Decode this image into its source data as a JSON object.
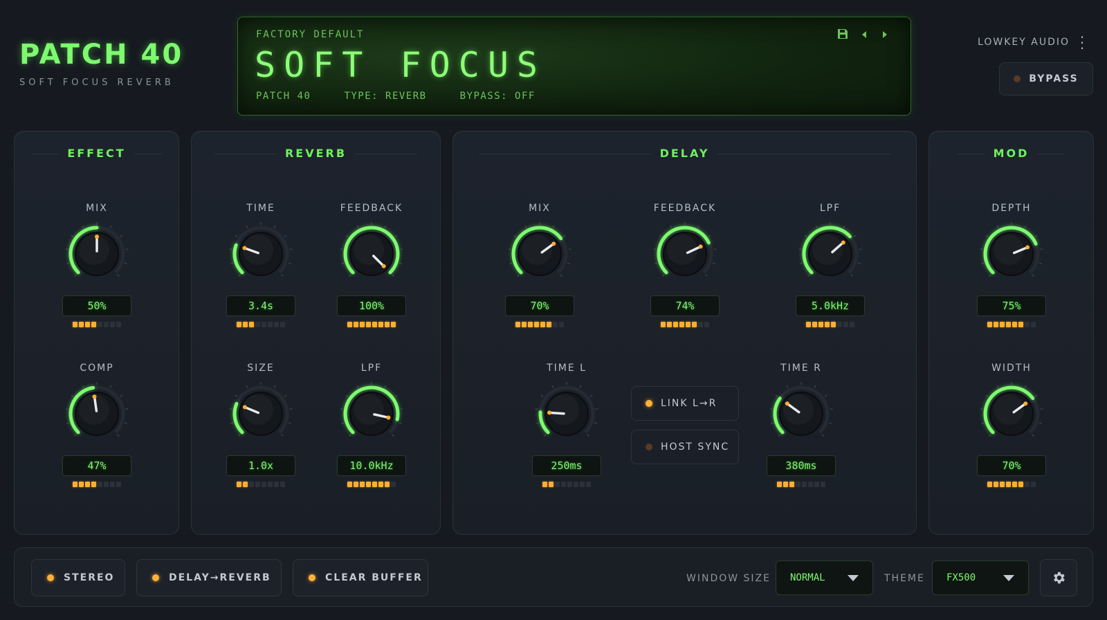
{
  "brand": {
    "title": "PATCH 40",
    "subtitle": "SOFT FOCUS REVERB"
  },
  "display": {
    "category": "FACTORY DEFAULT",
    "preset_name": "SOFT FOCUS",
    "info": [
      "PATCH 40",
      "TYPE: REVERB",
      "BYPASS: OFF"
    ],
    "icons": [
      "save-icon",
      "prev-preset-icon",
      "next-preset-icon"
    ]
  },
  "vendor": {
    "name": "LOWKEY AUDIO",
    "menu_icon": "kebab-menu-icon"
  },
  "bypass": {
    "label": "BYPASS",
    "active": false
  },
  "colors": {
    "accent_green": "#7dfa6e",
    "led_amber": "#ffae33",
    "panel_bg": "#1c222a"
  },
  "panels": {
    "effect": {
      "title": "EFFECT",
      "knobs": [
        {
          "label": "MIX",
          "value": "50%",
          "level": 0.5,
          "segments": 4
        },
        {
          "label": "COMP",
          "value": "47%",
          "level": 0.47,
          "segments": 4
        }
      ]
    },
    "reverb": {
      "title": "REVERB",
      "knobs": [
        {
          "label": "TIME",
          "value": "3.4s",
          "level": 0.24,
          "segments": 3
        },
        {
          "label": "FEEDBACK",
          "value": "100%",
          "level": 1.0,
          "segments": 8
        },
        {
          "label": "SIZE",
          "value": "1.0x",
          "level": 0.25,
          "segments": 2
        },
        {
          "label": "LPF",
          "value": "10.0kHz",
          "level": 0.88,
          "segments": 7
        }
      ]
    },
    "delay": {
      "title": "DELAY",
      "knobs": [
        {
          "label": "MIX",
          "value": "70%",
          "level": 0.7,
          "segments": 6
        },
        {
          "label": "FEEDBACK",
          "value": "74%",
          "level": 0.74,
          "segments": 6
        },
        {
          "label": "LPF",
          "value": "5.0kHz",
          "level": 0.68,
          "segments": 5
        },
        {
          "label": "TIME L",
          "value": "250ms",
          "level": 0.18,
          "segments": 2
        },
        {
          "label": "TIME R",
          "value": "380ms",
          "level": 0.3,
          "segments": 3
        }
      ],
      "toggles": [
        {
          "label": "LINK L→R",
          "active": true
        },
        {
          "label": "HOST SYNC",
          "active": false
        }
      ]
    },
    "mod": {
      "title": "MOD",
      "knobs": [
        {
          "label": "DEPTH",
          "value": "75%",
          "level": 0.75,
          "segments": 6
        },
        {
          "label": "WIDTH",
          "value": "70%",
          "level": 0.7,
          "segments": 6
        }
      ]
    }
  },
  "footer": {
    "buttons": [
      {
        "label": "STEREO",
        "active": true
      },
      {
        "label": "DELAY→REVERB",
        "active": true
      },
      {
        "label": "CLEAR BUFFER",
        "active": true
      }
    ],
    "window_size": {
      "label": "WINDOW SIZE",
      "value": "NORMAL"
    },
    "theme": {
      "label": "THEME",
      "value": "FX500"
    },
    "settings_icon": "gear-icon"
  }
}
